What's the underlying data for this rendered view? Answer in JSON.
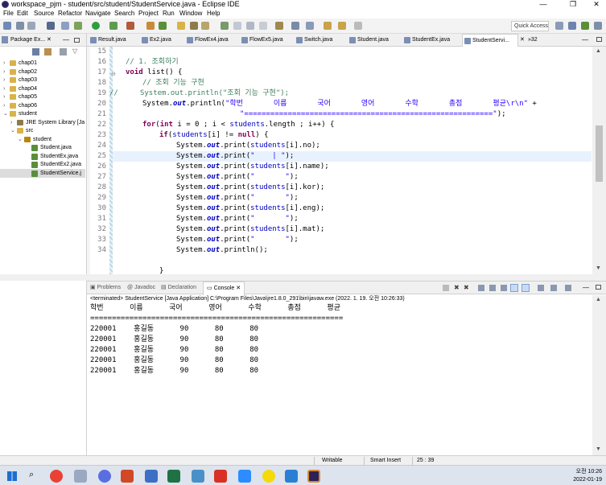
{
  "window": {
    "title": "workspace_pjm - student/src/student/StudentService.java - Eclipse IDE",
    "min": "—",
    "max": "❐",
    "close": "✕"
  },
  "menu": [
    "File",
    "Edit",
    "Source",
    "Refactor",
    "Navigate",
    "Search",
    "Project",
    "Run",
    "Window",
    "Help"
  ],
  "quick_access": "Quick Access",
  "tabs": [
    "Result.java",
    "Ex2.java",
    "FlowEx4.java",
    "FlowEx5.java",
    "Switch.java",
    "Student.java",
    "StudentEx.java",
    "StudentServi...",
    "»32"
  ],
  "package_explorer": {
    "title": "Package Ex...",
    "items": [
      {
        "label": "chap01",
        "level": 0,
        "type": "folder"
      },
      {
        "label": "chap02",
        "level": 0,
        "type": "folder"
      },
      {
        "label": "chap03",
        "level": 0,
        "type": "folder"
      },
      {
        "label": "chap04",
        "level": 0,
        "type": "folder"
      },
      {
        "label": "chap05",
        "level": 0,
        "type": "folder"
      },
      {
        "label": "chap06",
        "level": 0,
        "type": "folder"
      },
      {
        "label": "student",
        "level": 0,
        "type": "folder"
      },
      {
        "label": "JRE System Library [Ja",
        "level": 1,
        "type": "lib"
      },
      {
        "label": "src",
        "level": 1,
        "type": "folder"
      },
      {
        "label": "student",
        "level": 2,
        "type": "pkg"
      },
      {
        "label": "Student.java",
        "level": 3,
        "type": "java"
      },
      {
        "label": "StudentEx.java",
        "level": 3,
        "type": "java"
      },
      {
        "label": "StudentEx2.java",
        "level": 3,
        "type": "java"
      },
      {
        "label": "StudentService.j",
        "level": 3,
        "type": "java"
      }
    ]
  },
  "line_numbers": [
    "15",
    "16",
    "17",
    "18",
    "19",
    "20",
    "21",
    "22",
    "23",
    "24",
    "25",
    "26",
    "27",
    "28",
    "29",
    "30",
    "31",
    "32",
    "33",
    "34"
  ],
  "code": {
    "l16": "// 1. 조회하기",
    "l17_kw": "void",
    "l17_rest": " list() {",
    "l18": "// 조회 기능 구현",
    "l19": "System.out.println(\"조회 기능 구현\");",
    "l20_a": "System.",
    "l20_out": "out",
    "l20_b": ".println(",
    "l20_str": "\"학번       이름       국어       영어       수학       총점       평균\\r\\n\"",
    "l20_c": " +",
    "l21_str": "\"=========================================================\"",
    "l21_c": ");",
    "l23_kw": "for",
    "l23_a": "(",
    "l23_int": "int",
    "l23_b": " i = 0 ; i < ",
    "l23_students": "students",
    "l23_c": ".length ; i++) {",
    "l24_kw": "if",
    "l24_a": "(",
    "l24_b": "students",
    "l24_c": "[i] != ",
    "l24_null": "null",
    "l24_d": ") {",
    "p_sys": "System.",
    "p_out": "out",
    "p_print": ".print(",
    "p_println": ".println();",
    "students": "students",
    "l25_str": "\"    | \"",
    "l26_f": "[i].name",
    "l27_str": "\"       \"",
    "l28_f": "[i].kor",
    "l29_str": "\"       \"",
    "l30_f": "[i].eng",
    "l31_str": "\"       \"",
    "l32_f": "[i].mat",
    "l33_str": "\"       \"",
    "l24no": "[i].no",
    "close": ");",
    "end": "}"
  },
  "console": {
    "tabs": [
      "Problems",
      "Javadoc",
      "Declaration",
      "Console"
    ],
    "terminated": "<terminated> StudentService [Java Application] C:\\Program Files\\Java\\jre1.8.0_291\\bin\\javaw.exe (2022. 1. 19. 오전 10:26:33)",
    "header": "학번      이름      국어      영어      수학      총점      평균",
    "divider": "==========================================================",
    "rows": [
      "220001    홍길동      90      80      80",
      "220001    홍길동      90      80      80",
      "220001    홍길동      90      80      80",
      "220001    홍길동      90      80      80",
      "220001    홍길동      90      80      80"
    ]
  },
  "status": {
    "writable": "Writable",
    "insert": "Smart Insert",
    "position": "25 : 39"
  },
  "taskbar": {
    "time": "오전 10:26",
    "date": "2022-01-19"
  }
}
